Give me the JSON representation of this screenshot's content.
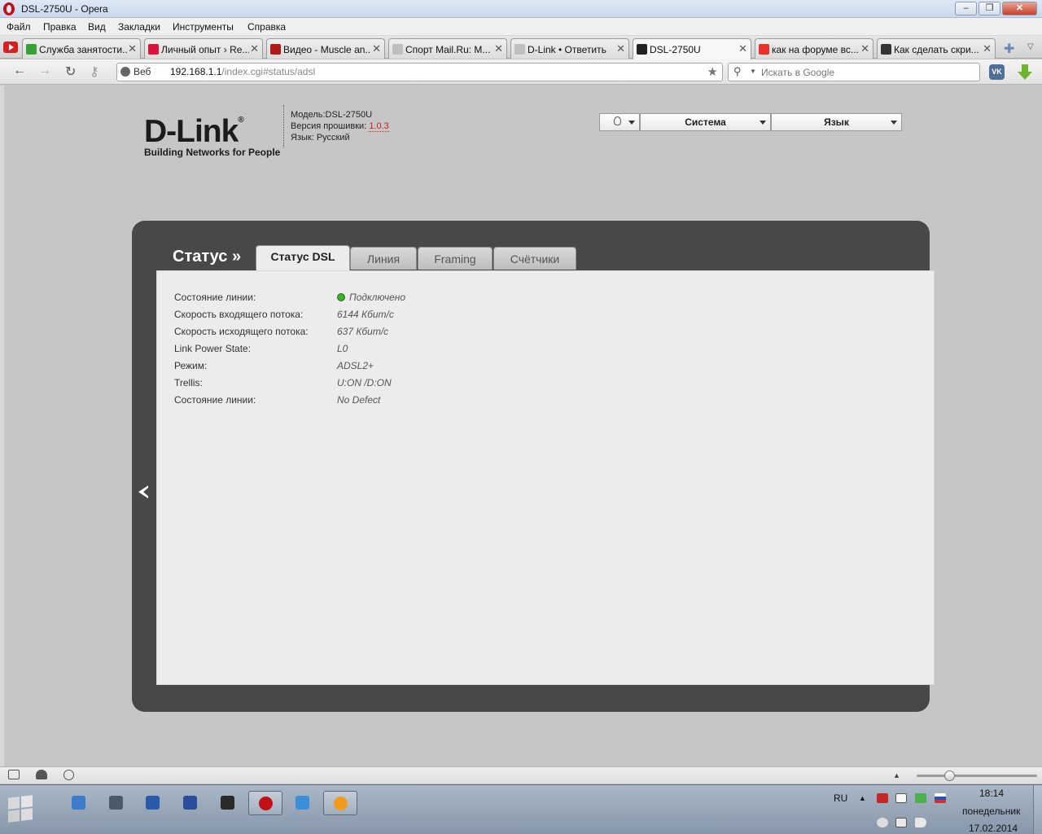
{
  "window": {
    "title": "DSL-2750U - Opera",
    "controls": [
      "–",
      "❐",
      "✕"
    ]
  },
  "menubar": [
    "Файл",
    "Правка",
    "Вид",
    "Закладки",
    "Инструменты",
    "Справка"
  ],
  "tabs": [
    {
      "label": "Служба занятости...",
      "favicon_color": "#3a9e3a",
      "active": false
    },
    {
      "label": "Личный опыт › Re...",
      "favicon_color": "#d8143a",
      "active": false
    },
    {
      "label": "Видео - Muscle an...",
      "favicon_color": "#b11a1a",
      "active": false
    },
    {
      "label": "Спорт Mail.Ru: M...",
      "favicon_color": "#bfbfbf",
      "active": false
    },
    {
      "label": "D-Link • Ответить",
      "favicon_color": "#bfbfbf",
      "active": false
    },
    {
      "label": "DSL-2750U",
      "favicon_color": "#222222",
      "active": true
    },
    {
      "label": "как на форуме вс...",
      "favicon_color": "#e8322a",
      "active": false
    },
    {
      "label": "Как сделать скри...",
      "favicon_color": "#333333",
      "active": false
    }
  ],
  "tab_close": "✕",
  "new_tab": "✚",
  "tab_list_arrow": "▽",
  "nav": {
    "back": "←",
    "forward": "→",
    "reload": "↻",
    "key": "⚷"
  },
  "address": {
    "badge": "Веб",
    "host": "192.168.1.1",
    "path": "/index.cgi#status/adsl"
  },
  "search": {
    "placeholder": "Искать в Google"
  },
  "toolbar_buttons": {
    "vk": "VK"
  },
  "router": {
    "logo": "D-Link",
    "logo_reg": "®",
    "tagline": "Building Networks for People",
    "model_label": "Модель:",
    "model": "DSL-2750U",
    "firmware_label": "Версия прошивки:",
    "firmware": "1.0.3",
    "language_label": "Язык:",
    "language": "Русский",
    "menu": {
      "system": "Система",
      "language": "Язык"
    },
    "section_title": "Статус »",
    "tabs": [
      "Статус DSL",
      "Линия",
      "Framing",
      "Счётчики"
    ],
    "active_tab": 0,
    "status_rows": [
      {
        "key": "Состояние линии:",
        "value": "Подключено",
        "indicator": "green"
      },
      {
        "key": "Скорость входящего потока:",
        "value": "6144 Кбит/с"
      },
      {
        "key": "Скорость исходящего потока:",
        "value": "637 Кбит/с"
      },
      {
        "key": "Link Power State:",
        "value": "L0"
      },
      {
        "key": "Режим:",
        "value": "ADSL2+"
      },
      {
        "key": "Trellis:",
        "value": "U:ON /D:ON"
      },
      {
        "key": "Состояние линии:",
        "value": "No Defect"
      }
    ]
  },
  "taskbar": {
    "apps": [
      {
        "name": "desktop-app-icon",
        "color": "#3d7cc9"
      },
      {
        "name": "media-app-icon",
        "color": "#4a5a6a"
      },
      {
        "name": "word-app-icon",
        "color": "#2b5aa8"
      },
      {
        "name": "save-app-icon",
        "color": "#2a4d9c"
      },
      {
        "name": "game-app-icon",
        "color": "#2a2a2a"
      },
      {
        "name": "opera-app-icon",
        "color": "#c40f16"
      },
      {
        "name": "ie-app-icon",
        "color": "#3a8fd6"
      },
      {
        "name": "mail-agent-app-icon",
        "color": "#f29a1e"
      }
    ],
    "lang": "RU",
    "tray_up": "▲",
    "time": "18:14",
    "day": "понедельник",
    "date": "17.02.2014"
  }
}
